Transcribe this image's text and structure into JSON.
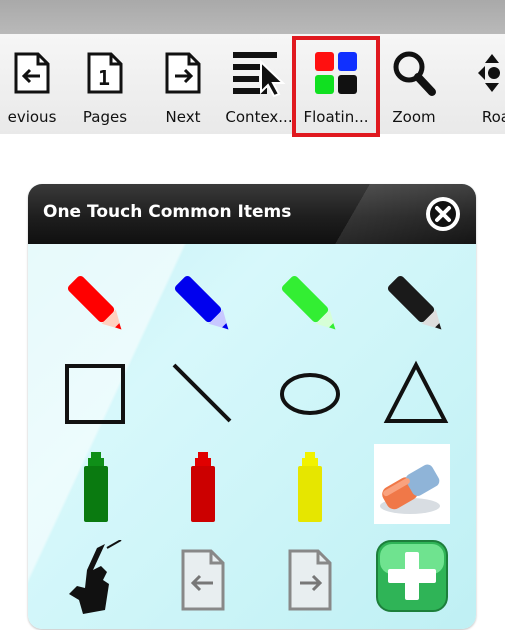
{
  "toolbar": {
    "items": [
      {
        "label": "evious",
        "icon": "previous-page-icon"
      },
      {
        "label": "Pages",
        "icon": "pages-icon"
      },
      {
        "label": "Next",
        "icon": "next-page-icon"
      },
      {
        "label": "Contex...",
        "icon": "context-select-icon"
      },
      {
        "label": "Floatin...",
        "icon": "floating-tools-icon",
        "selected": true
      },
      {
        "label": "Zoom",
        "icon": "zoom-icon"
      },
      {
        "label": "Roar",
        "icon": "roam-icon"
      }
    ],
    "selected_color": "#e0191f"
  },
  "palette": {
    "title": "One Touch Common Items",
    "close_icon": "close-icon",
    "items": [
      {
        "name": "red-pen",
        "icon": "pen-icon",
        "color": "#ff0000"
      },
      {
        "name": "blue-pen",
        "icon": "pen-icon",
        "color": "#0000ee"
      },
      {
        "name": "green-pen",
        "icon": "pen-icon",
        "color": "#33ee33"
      },
      {
        "name": "black-pen",
        "icon": "pen-icon",
        "color": "#1a1a1a"
      },
      {
        "name": "rectangle-shape",
        "icon": "rectangle-icon"
      },
      {
        "name": "line-shape",
        "icon": "line-icon"
      },
      {
        "name": "ellipse-shape",
        "icon": "ellipse-icon"
      },
      {
        "name": "triangle-shape",
        "icon": "triangle-icon"
      },
      {
        "name": "green-highlighter",
        "icon": "highlighter-icon",
        "color": "#0a7a10"
      },
      {
        "name": "red-highlighter",
        "icon": "highlighter-icon",
        "color": "#cc0000"
      },
      {
        "name": "yellow-highlighter",
        "icon": "highlighter-icon",
        "color": "#e6e600"
      },
      {
        "name": "eraser",
        "icon": "eraser-icon"
      },
      {
        "name": "select-hand",
        "icon": "hand-pointer-icon"
      },
      {
        "name": "previous-page",
        "icon": "previous-page-icon"
      },
      {
        "name": "next-page",
        "icon": "next-page-icon"
      },
      {
        "name": "add-item",
        "icon": "plus-icon",
        "color": "#3fcf67"
      }
    ]
  }
}
